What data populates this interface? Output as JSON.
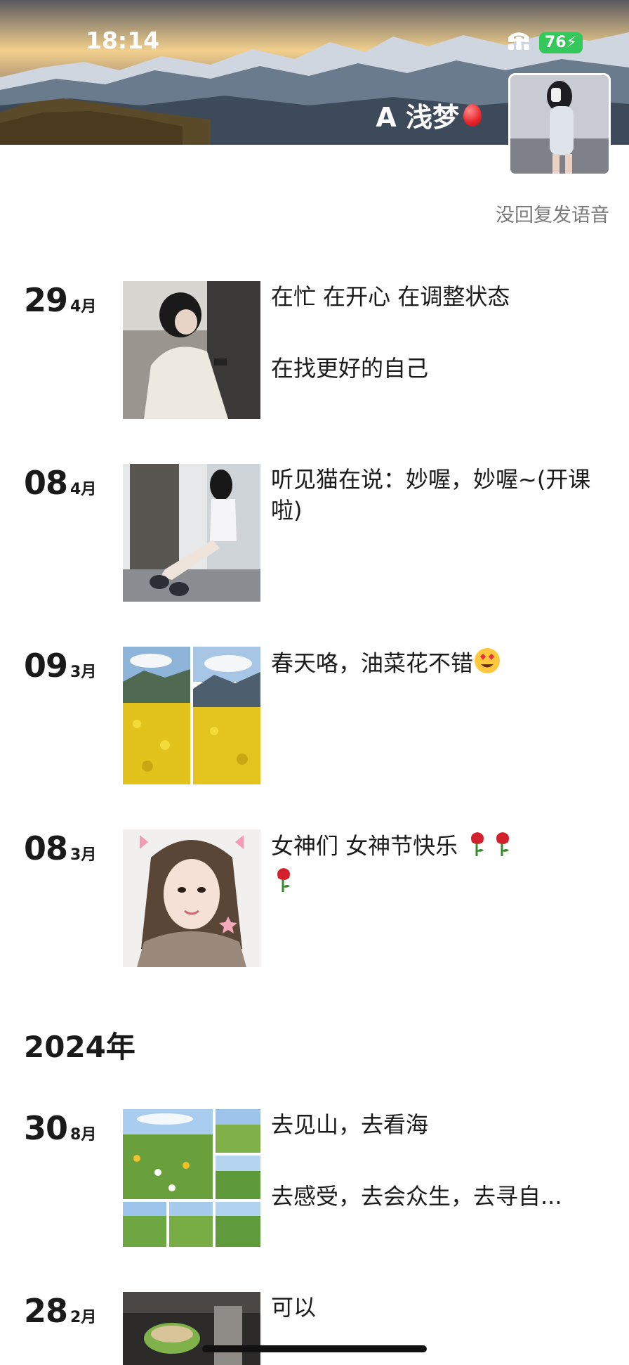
{
  "status_bar": {
    "time": "18:14",
    "battery": "76"
  },
  "profile": {
    "name": "A 浅梦",
    "signature": "没回复发语音"
  },
  "posts_2025": [
    {
      "day": "29",
      "month": "4月",
      "lines": [
        "在忙 在开心 在调整状态",
        "在找更好的自己"
      ]
    },
    {
      "day": "08",
      "month": "4月",
      "lines": [
        "听见猫在说：妙喔，妙喔~(开课啦)"
      ]
    },
    {
      "day": "09",
      "month": "3月",
      "lines": [
        "春天咯，油菜花不错"
      ]
    },
    {
      "day": "08",
      "month": "3月",
      "lines": [
        "女神们  女神节快乐 "
      ]
    }
  ],
  "year_divider": "2024年",
  "posts_2024": [
    {
      "day": "30",
      "month": "8月",
      "lines": [
        "去见山，去看海",
        "去感受，去会众生，去寻自..."
      ]
    },
    {
      "day": "28",
      "month": "2月",
      "lines": [
        "可以"
      ]
    }
  ],
  "colors": {
    "battery_green": "#34c759",
    "signature_gray": "#7a7a7a"
  }
}
